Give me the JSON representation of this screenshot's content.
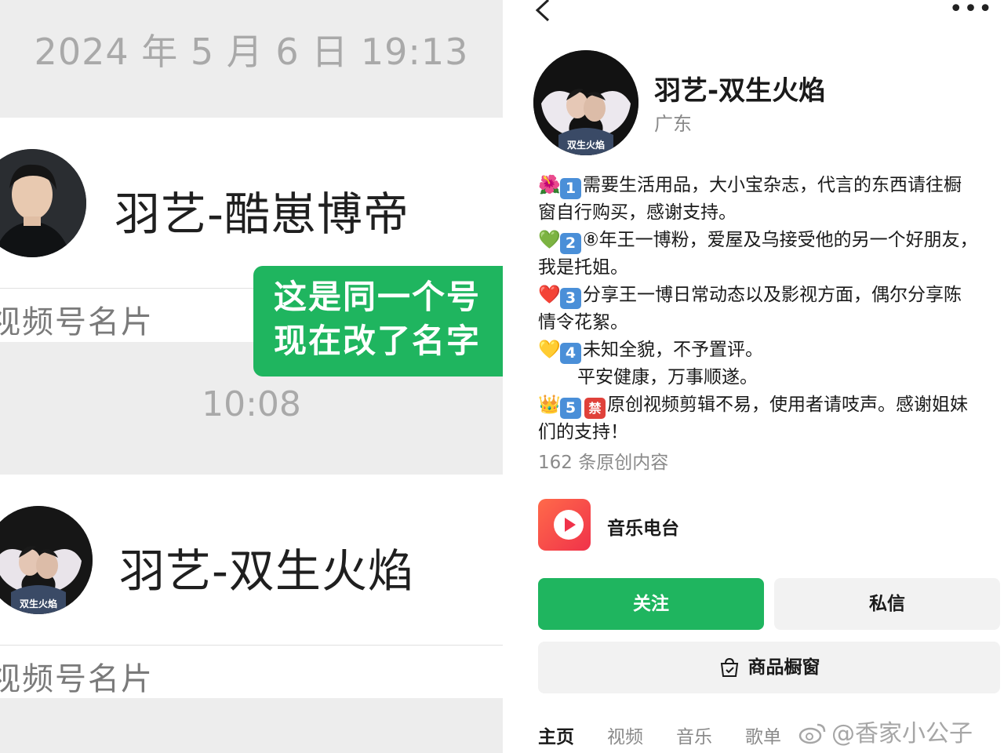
{
  "left_panel": {
    "timestamp_1": "2024 年 5 月 6 日 19:13",
    "card_1": {
      "name": "羽艺-酷崽博帝",
      "subtitle": "视频号名片"
    },
    "callout": {
      "line_1": "这是同一个号",
      "line_2": "现在改了名字"
    },
    "timestamp_2": "10:08",
    "card_2": {
      "name": "羽艺-双生火焰",
      "subtitle": "视频号名片",
      "avatar_caption": "双生火焰"
    }
  },
  "right_panel": {
    "nav": {
      "back_icon": "chevron-left-icon",
      "more_label": "•••"
    },
    "profile": {
      "name": "羽艺-双生火焰",
      "location": "广东",
      "avatar_caption": "双生火焰"
    },
    "bio": {
      "l1": {
        "emoji": "🌺",
        "key": "1",
        "text": "需要生活用品，大小宝杂志，代言的东西请往橱"
      },
      "l2": "窗自行购买，感谢支持。",
      "l3": {
        "emoji": "💚",
        "key": "2",
        "text": "⑧年王一博粉，爱屋及乌接受他的另一个好朋友，"
      },
      "l4": "我是托姐。",
      "l5": {
        "emoji": "❤️",
        "key": "3",
        "text": "分享王一博日常动态以及影视方面，偶尔分享陈"
      },
      "l6": "情令花絮。",
      "l7": {
        "emoji": "💛",
        "key": "4",
        "text": "未知全貌，不予置评。"
      },
      "l8": "平安健康，万事顺遂。",
      "l9": {
        "emoji": "👑",
        "key": "5",
        "ban": "禁",
        "text": "原创视频剪辑不易，使用者请吱声。感谢姐妹"
      },
      "l10": "们的支持！"
    },
    "original_count": "162 条原创内容",
    "music": {
      "label": "音乐电台",
      "icon": "play-icon"
    },
    "buttons": {
      "follow": "关注",
      "message": "私信",
      "shop": "商品橱窗",
      "shop_icon": "shopping-bag-icon"
    },
    "tabs": [
      "主页",
      "视频",
      "音乐",
      "歌单"
    ],
    "watermark": "@香家小公子"
  },
  "colors": {
    "accent_green": "#1fb55f",
    "chat_bg": "#ededed",
    "key_blue": "#4a8fd8"
  }
}
